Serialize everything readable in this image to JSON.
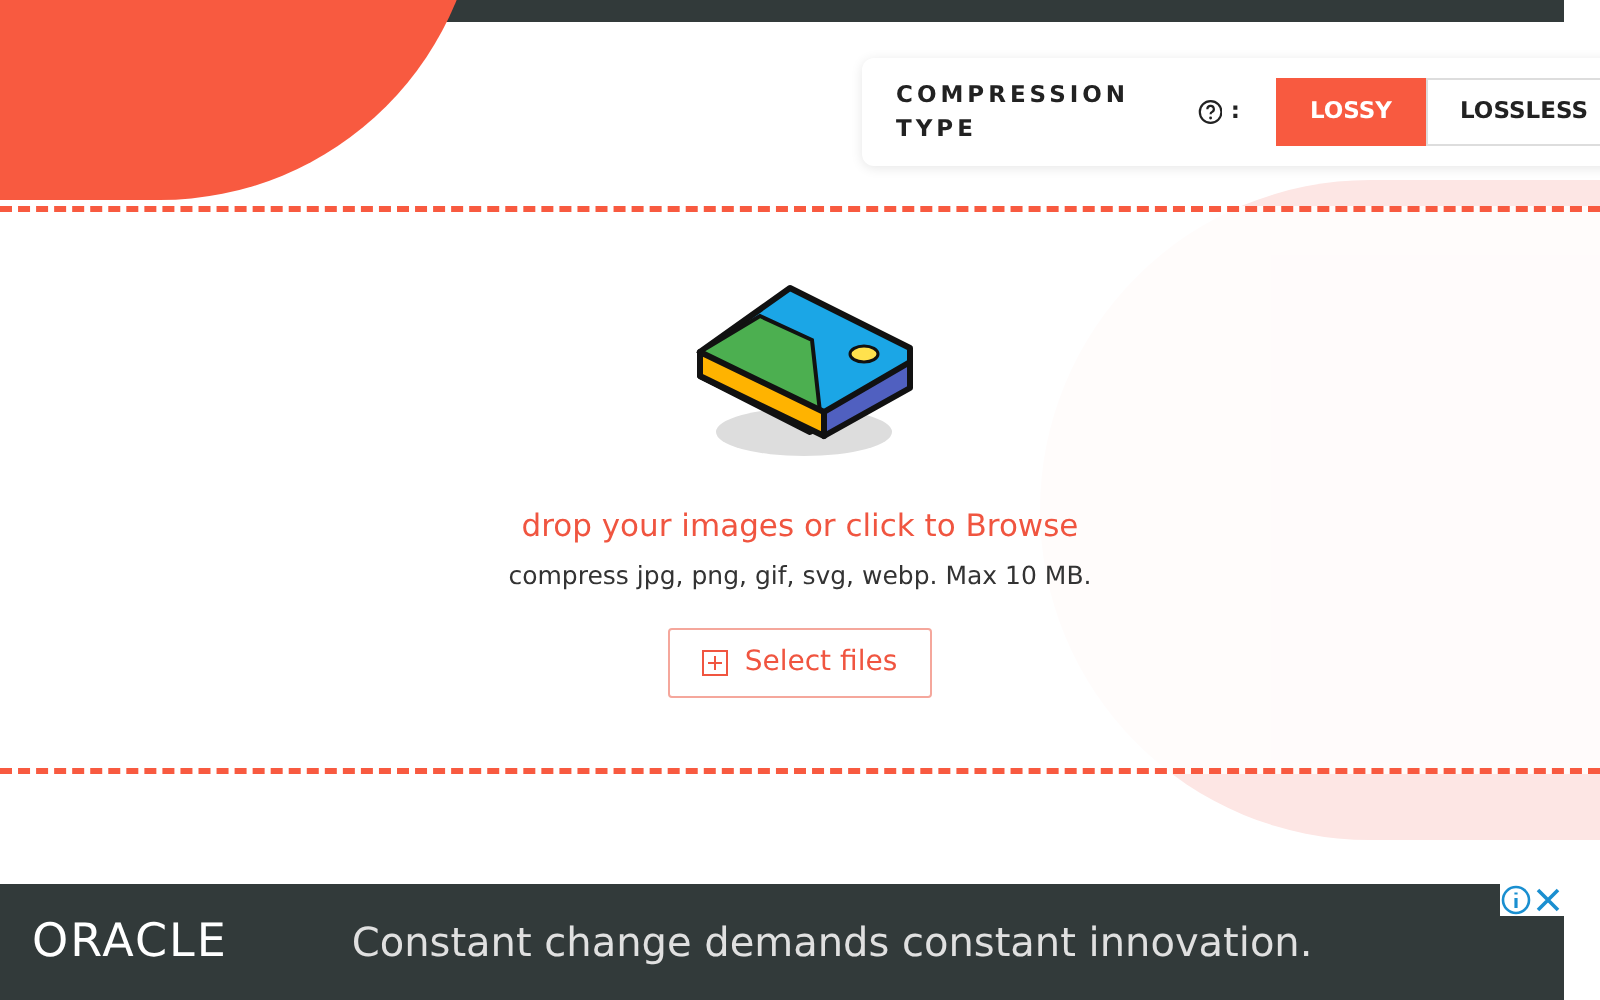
{
  "compression": {
    "label": "COMPRESSION TYPE",
    "separator": ":",
    "options": [
      {
        "label": "LOSSY",
        "selected": true
      },
      {
        "label": "LOSSLESS",
        "selected": false
      }
    ]
  },
  "dropzone": {
    "title": "drop your images or click to Browse",
    "subtitle": "compress jpg, png, gif, svg, webp. Max 10 MB.",
    "button": "Select files"
  },
  "ad": {
    "logo": "ORACLE",
    "headline": "Constant change demands constant innovation."
  }
}
